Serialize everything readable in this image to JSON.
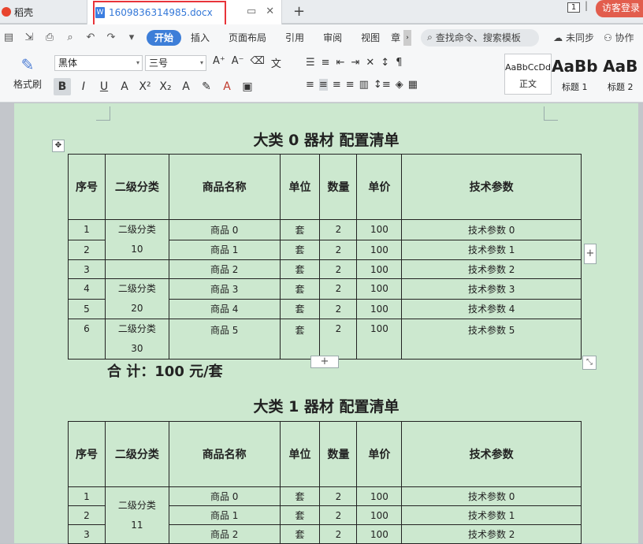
{
  "tabs": {
    "home_label": "稻壳",
    "doc_title": "1609836314985.docx",
    "doc_icon": "W",
    "page_badge": "1",
    "login_label": "访客登录"
  },
  "menu": {
    "items": [
      "开始",
      "插入",
      "页面布局",
      "引用",
      "审阅",
      "视图",
      "章"
    ],
    "search_placeholder": "查找命令、搜索模板",
    "sync_label": "未同步",
    "collab_label": "协作"
  },
  "ribbon": {
    "format_painter": "格式刷",
    "font_name": "黑体",
    "font_size": "三号",
    "styles": [
      {
        "sample": "AaBbCcDd",
        "label": "正文"
      },
      {
        "sample": "AaBb",
        "label": "标题 1"
      },
      {
        "sample": "AaB",
        "label": "标题 2"
      }
    ]
  },
  "document": {
    "section0": {
      "title": "大类 0 器材  配置清单",
      "headers": [
        "序号",
        "二级分类",
        "商品名称",
        "单位",
        "数量",
        "单价",
        "技术参数"
      ],
      "rows": [
        {
          "no": "1",
          "name": "商品 0",
          "unit": "套",
          "qty": "2",
          "price": "100",
          "spec": "技术参数 0"
        },
        {
          "no": "2",
          "name": "商品 1",
          "unit": "套",
          "qty": "2",
          "price": "100",
          "spec": "技术参数 1"
        },
        {
          "no": "3",
          "name": "商品 2",
          "unit": "套",
          "qty": "2",
          "price": "100",
          "spec": "技术参数 2"
        },
        {
          "no": "4",
          "name": "商品 3",
          "unit": "套",
          "qty": "2",
          "price": "100",
          "spec": "技术参数 3"
        },
        {
          "no": "5",
          "name": "商品 4",
          "unit": "套",
          "qty": "2",
          "price": "100",
          "spec": "技术参数 4"
        },
        {
          "no": "6",
          "name": "商品 5",
          "unit": "套",
          "qty": "2",
          "price": "100",
          "spec": "技术参数 5"
        }
      ],
      "categories": [
        {
          "line1": "二级分类",
          "line2": "10"
        },
        {
          "line1": "二级分类",
          "line2": "20"
        },
        {
          "line1": "二级分类",
          "line2": "30"
        }
      ],
      "total": "合   计：100 元/套"
    },
    "section1": {
      "title": "大类 1 器材  配置清单",
      "headers": [
        "序号",
        "二级分类",
        "商品名称",
        "单位",
        "数量",
        "单价",
        "技术参数"
      ],
      "rows": [
        {
          "no": "1",
          "name": "商品 0",
          "unit": "套",
          "qty": "2",
          "price": "100",
          "spec": "技术参数 0"
        },
        {
          "no": "2",
          "name": "商品 1",
          "unit": "套",
          "qty": "2",
          "price": "100",
          "spec": "技术参数 1"
        },
        {
          "no": "3",
          "name": "商品 2",
          "unit": "套",
          "qty": "2",
          "price": "100",
          "spec": "技术参数 2"
        }
      ],
      "categories": [
        {
          "line1": "二级分类",
          "line2": "11"
        }
      ]
    }
  }
}
